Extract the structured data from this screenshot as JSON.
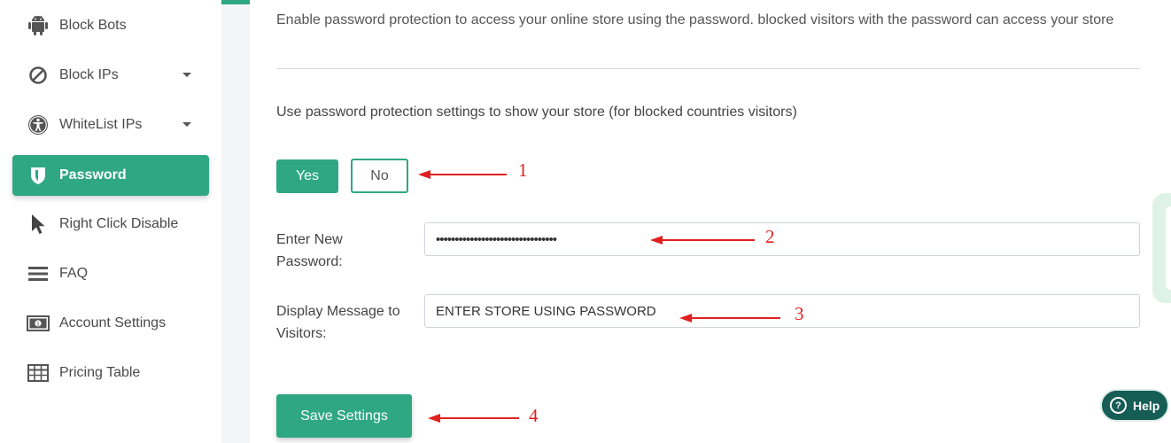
{
  "sidebar": {
    "items": [
      {
        "label": "Block Bots",
        "icon": "android-icon"
      },
      {
        "label": "Block IPs",
        "icon": "block-icon",
        "has_dropdown": true
      },
      {
        "label": "WhiteList IPs",
        "icon": "accessibility-icon",
        "has_dropdown": true
      },
      {
        "label": "Password",
        "icon": "shield-icon",
        "active": true
      },
      {
        "label": "Right Click Disable",
        "icon": "cursor-icon"
      },
      {
        "label": "FAQ",
        "icon": "menu-icon"
      },
      {
        "label": "Account Settings",
        "icon": "money-icon"
      },
      {
        "label": "Pricing Table",
        "icon": "table-icon"
      }
    ]
  },
  "main": {
    "intro": "Enable password protection to access your online store using the password. blocked visitors with the password can access your store",
    "question": "Use password protection settings to show your store (for blocked countries visitors)",
    "yes_label": "Yes",
    "no_label": "No",
    "password_label": "Enter New Password:",
    "password_value": "••••••••••••••••••••••••••••••••",
    "message_label": "Display Message to Visitors:",
    "message_value": "ENTER STORE USING PASSWORD",
    "save_label": "Save Settings"
  },
  "annotations": [
    "1",
    "2",
    "3",
    "4"
  ],
  "help": {
    "label": "Help"
  },
  "colors": {
    "accent": "#2fa783",
    "annotation": "#e02020",
    "help_bg": "#165d56"
  }
}
